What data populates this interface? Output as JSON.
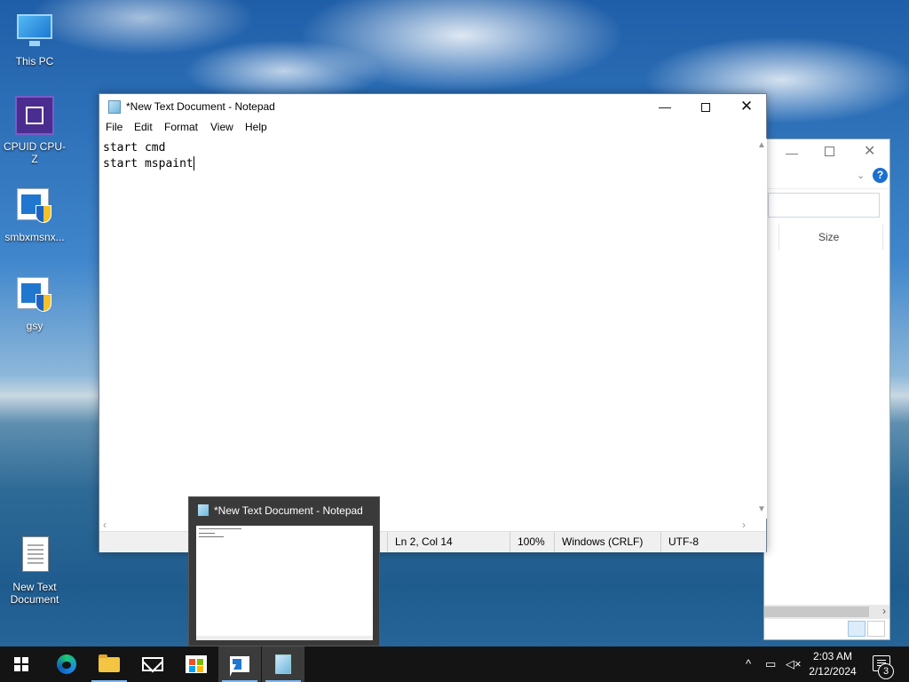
{
  "desktop": {
    "icons": [
      {
        "label": "This PC"
      },
      {
        "label": "CPUID CPU-Z"
      },
      {
        "label": "smbxmsnx..."
      },
      {
        "label": "gsy"
      },
      {
        "label": "New Text Document"
      }
    ]
  },
  "explorer": {
    "column_size": "Size"
  },
  "notepad": {
    "title": "*New Text Document - Notepad",
    "menu": [
      "File",
      "Edit",
      "Format",
      "View",
      "Help"
    ],
    "lines": [
      "start cmd",
      "start mspaint"
    ],
    "status": {
      "position": "Ln 2, Col 14",
      "zoom": "100%",
      "line_endings": "Windows (CRLF)",
      "encoding": "UTF-8"
    }
  },
  "preview": {
    "title": "*New Text Document - Notepad"
  },
  "taskbar": {
    "apps": [
      {
        "icon": "windows-start-icon"
      },
      {
        "icon": "edge-icon"
      },
      {
        "icon": "file-explorer-icon"
      },
      {
        "icon": "mail-icon"
      },
      {
        "icon": "store-icon"
      },
      {
        "icon": "app-window-icon"
      },
      {
        "icon": "notepad-icon"
      }
    ],
    "clock": {
      "time": "2:03 AM",
      "date": "2/12/2024"
    },
    "notification_count": "3"
  }
}
